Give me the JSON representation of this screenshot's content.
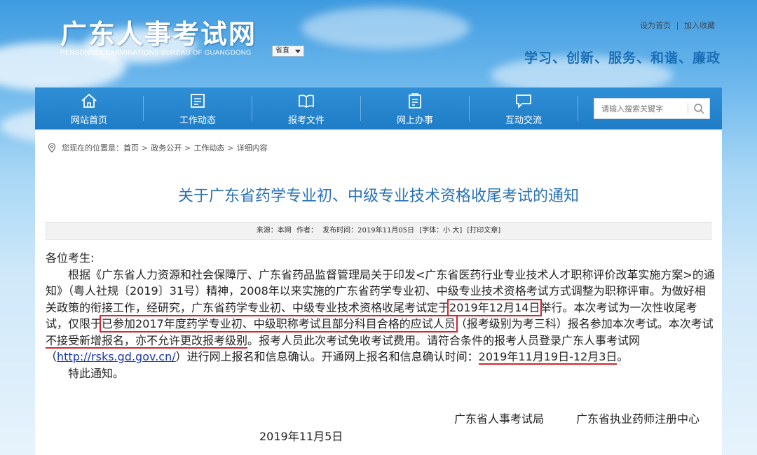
{
  "header": {
    "site_title": "广东人事考试网",
    "site_subtitle": "PERSONNEL EXAMINATIONS BUREAU OF GUANGDONG",
    "region_select": "省直",
    "links": [
      "设为首页",
      "|",
      "加入收藏"
    ],
    "slogan": "学习、创新、服务、和谐、廉政"
  },
  "nav": {
    "items": [
      {
        "label": "网站首页",
        "icon": "home-icon"
      },
      {
        "label": "工作动态",
        "icon": "list-icon"
      },
      {
        "label": "报考文件",
        "icon": "book-icon"
      },
      {
        "label": "网上办事",
        "icon": "clipboard-icon"
      },
      {
        "label": "互动交流",
        "icon": "chat-icon"
      }
    ],
    "search_placeholder": "请输入搜索关键字"
  },
  "breadcrumb": {
    "prefix": "您现在的位置是：",
    "items": [
      "首页",
      "政务公开",
      "工作动态",
      "详细内容"
    ],
    "separator": ">"
  },
  "article": {
    "title": "关于广东省药学专业初、中级专业技术资格收尾考试的通知",
    "meta": {
      "source": "来源：本网",
      "author": "作者：",
      "published": "发布时间：2019年11月05日",
      "font_size": "[字体：小 大]",
      "print": "[打印文章]"
    },
    "greeting": "各位考生:",
    "p1_a": "根据《广东省人力资源和社会保障厅、广东省药品监督管理局关于印发<广东省医药行业专业技术人才职称评价改革实施方案>的通知》（粤人社规〔2019〕31号）精神，2008年以来实施的广东省药学专业初、中级专业技术资格考试方式调整为职称评审。为做好相关政策的衔接工作，经研究，广东省药学专业初、中级专业技术资格收尾考试定于",
    "p1_date": "2019年12月14日",
    "p1_b": "举行。本次考试为一次性收尾考试，仅限于",
    "p1_scope": "已参加2017年度药学专业初、中级职称考试且部分科目合格的应试人员",
    "p1_c": "（报考级别为考三科）报名参加本次考试。本次考试",
    "p1_no_new": "不接受新增报名，亦不允许更改报考级别",
    "p1_d": "。报考人员此次考试免收考试费用。请符合条件的报考人员登录广东人事考试网（",
    "url": "http://rsks.gd.gov.cn/",
    "p1_e": "）进行网上报名和信息确认。开通网上报名和信息确认时间：",
    "p1_period": "2019年11月19日-12月3日",
    "p1_end": "。",
    "closing": "特此通知。",
    "signers": [
      "广东省人事考试局",
      "广东省执业药师注册中心"
    ],
    "date": "2019年11月5日"
  },
  "colors": {
    "nav_bg": "#1f7cc6",
    "title_blue": "#2a72b5",
    "highlight_red": "#d9232e",
    "slogan_blue": "#1b6fb5"
  }
}
